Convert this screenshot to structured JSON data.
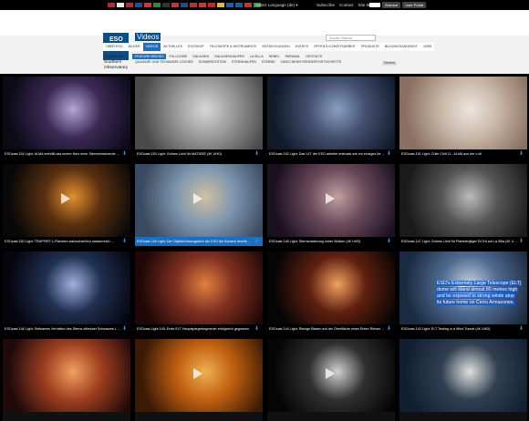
{
  "topbar": {
    "flags": [
      "#c0282d",
      "#e8e8e8",
      "#c0282d",
      "#1d4fa0",
      "#e03030",
      "#2a8a3a",
      "#333",
      "#d03030",
      "#1e4aa0",
      "#c03030",
      "#e03030",
      "#d02020",
      "#e0c020",
      "#1a60b0",
      "#1a5fa0",
      "#d03030",
      "#2a9a3a"
    ],
    "language": "Select Language (de) ▾",
    "links": [
      "Subscribe",
      "Contact",
      "Site Map"
    ],
    "buttons": [
      "Science",
      "User Portal"
    ]
  },
  "header": {
    "logo_text": "ESO",
    "site_name": "Videos",
    "search_placeholder": "Suche Videos",
    "org": "European Southern Observatory"
  },
  "nav": {
    "items": [
      "ÜBER ESO",
      "BILDER",
      "VIDEOS",
      "AKTUELLES",
      "ESOSHOP",
      "TELESKOPE & INSTRUMENTE",
      "ENTDECKUNGEN",
      "EVENTS",
      "ÖFFENTLICHKEITSARBEIT",
      "PRODUKTE",
      "BILDUNGSANGEBOT",
      "JOBS"
    ],
    "active": "VIDEOS"
  },
  "subnav": {
    "row1": [
      "FEATURE MOVIES",
      "FULLDOME",
      "GALAXIEN",
      "GALAXIENHAUFEN",
      "LA SILLA",
      "NEBEL",
      "PARANAL",
      "GESTALTE"
    ],
    "row2": [
      "QUASARE UND SCHWARZE LÖCHER",
      "SONNENSYSTEM",
      "STERNHAUFEN",
      "STERNE",
      "VIDEO NEWS RENDERFORTSCHRITTE"
    ],
    "active": "FEATURE MOVIES",
    "search_button": "Search"
  },
  "videos": [
    {
      "caption": "ESOcast 154 Light: ALMA enthüllt das innere Netz einer Sternentstehende ...",
      "palette": [
        "#0d0a18",
        "#3a2a55",
        "#b5a6d6"
      ],
      "play": false
    },
    {
      "caption": "ESOcast 153 Light: Grünes Licht für MATISSE (4K UHD)",
      "palette": [
        "#4a4a4a",
        "#9a9a9a",
        "#d8d8d8"
      ],
      "play": false
    },
    {
      "caption": "ESOcast 152 Light: Das VLT der ESO arbeitet erstmals wie ein einziges Ite ...",
      "palette": [
        "#101a2a",
        "#445070",
        "#8aa0c0"
      ],
      "play": false
    },
    {
      "caption": "ESOcast 151 Light: Chile Chill 11 - ALMA aus der Luft",
      "palette": [
        "#8a7060",
        "#c9b8a8",
        "#ece6e0"
      ],
      "play": false
    },
    {
      "caption": "ESOcast 150 Light: TRAPPIST-1-Planeten wahrscheinlich wasserreich ...",
      "palette": [
        "#080808",
        "#5a3010",
        "#e09030"
      ],
      "play": true
    },
    {
      "caption": "ESOcast 149 Light: Der Objektivlinsengabeln der ESO die Kamera bereits ...",
      "palette": [
        "#3a4a60",
        "#8098b0",
        "#d0c0a0"
      ],
      "play": true,
      "highlight": true
    },
    {
      "caption": "ESOcast 148 Light: Sternentstehung hinter Wolken (4K UHD)",
      "palette": [
        "#1a1020",
        "#6a4a5a",
        "#c0a0a0"
      ],
      "play": true
    },
    {
      "caption": "ESOcast 147 Light: Grünes Licht für Planetenjäger ExTrA auf La Silla (4K U ...",
      "palette": [
        "#1a1a1a",
        "#555",
        "#bbb"
      ],
      "play": false
    },
    {
      "caption": "ESOcast 146 Light: Seltsames Verhalten des Sterns offenbart Schwarzes L ...",
      "palette": [
        "#050510",
        "#203050",
        "#a0b0e0"
      ],
      "play": false
    },
    {
      "caption": "ESOcast Light 145: Erste ELT Hauptspiegelsegmente erfolgreich gegossen",
      "palette": [
        "#200808",
        "#803020",
        "#e08040"
      ],
      "play": false
    },
    {
      "caption": "ESOcast 144 Light: Riesige Blasen auf der Oberfläche eines Roten Riesen ...",
      "palette": [
        "#050505",
        "#602010",
        "#f0a060"
      ],
      "play": false
    },
    {
      "caption": "ESOcast 143 Light: ELT Testing in a Wind Tunnel (4K UHD)",
      "palette": [
        "#1a2a40",
        "#506a90",
        "#c0d0e0"
      ],
      "play": true,
      "overlay": [
        "ESO's Extremely Large Telescope (ELT)",
        "dome will stand almost 80 metres high",
        "and be exposed to strong winds atop",
        "its future home on Cerro Armazones."
      ]
    },
    {
      "caption": "",
      "palette": [
        "#200a0a",
        "#a04020",
        "#f0a060"
      ],
      "play": false
    },
    {
      "caption": "",
      "palette": [
        "#3a1a05",
        "#c06010",
        "#f0b050"
      ],
      "play": true
    },
    {
      "caption": "",
      "palette": [
        "#050505",
        "#303030",
        "#d0d0d0"
      ],
      "play": true
    },
    {
      "caption": "",
      "palette": [
        "#102030",
        "#304050",
        "#e0e0e0"
      ],
      "play": false
    }
  ]
}
